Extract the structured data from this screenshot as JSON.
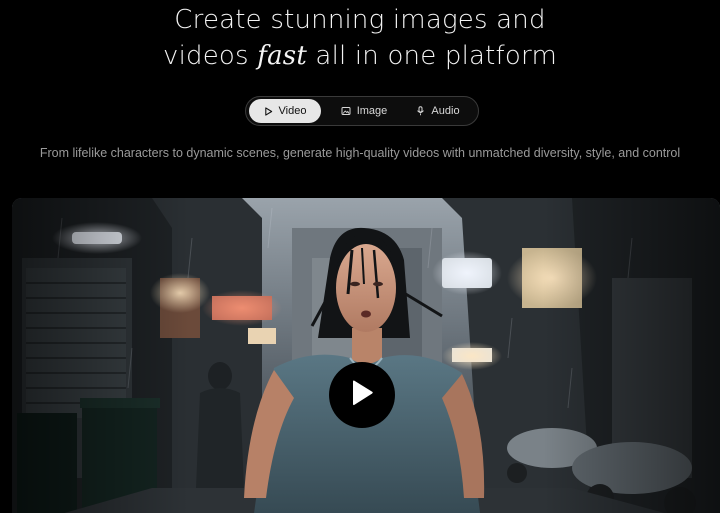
{
  "hero": {
    "line1": "Create stunning images and",
    "line2_before": "videos ",
    "line2_accent": "fast",
    "line2_after": " all in one platform"
  },
  "tabs": [
    {
      "label": "Video",
      "icon": "play-outline-icon",
      "active": true
    },
    {
      "label": "Image",
      "icon": "image-icon",
      "active": false
    },
    {
      "label": "Audio",
      "icon": "microphone-icon",
      "active": false
    }
  ],
  "description": "From lifelike characters to dynamic scenes, generate high-quality videos with unmatched diversity, style, and control",
  "video": {
    "subject": "woman running in a rainy neon-lit alley",
    "control_icon": "play-icon"
  },
  "colors": {
    "background": "#000000",
    "active_tab_bg": "#e7e7e7",
    "muted_text": "#9a9a9a"
  }
}
